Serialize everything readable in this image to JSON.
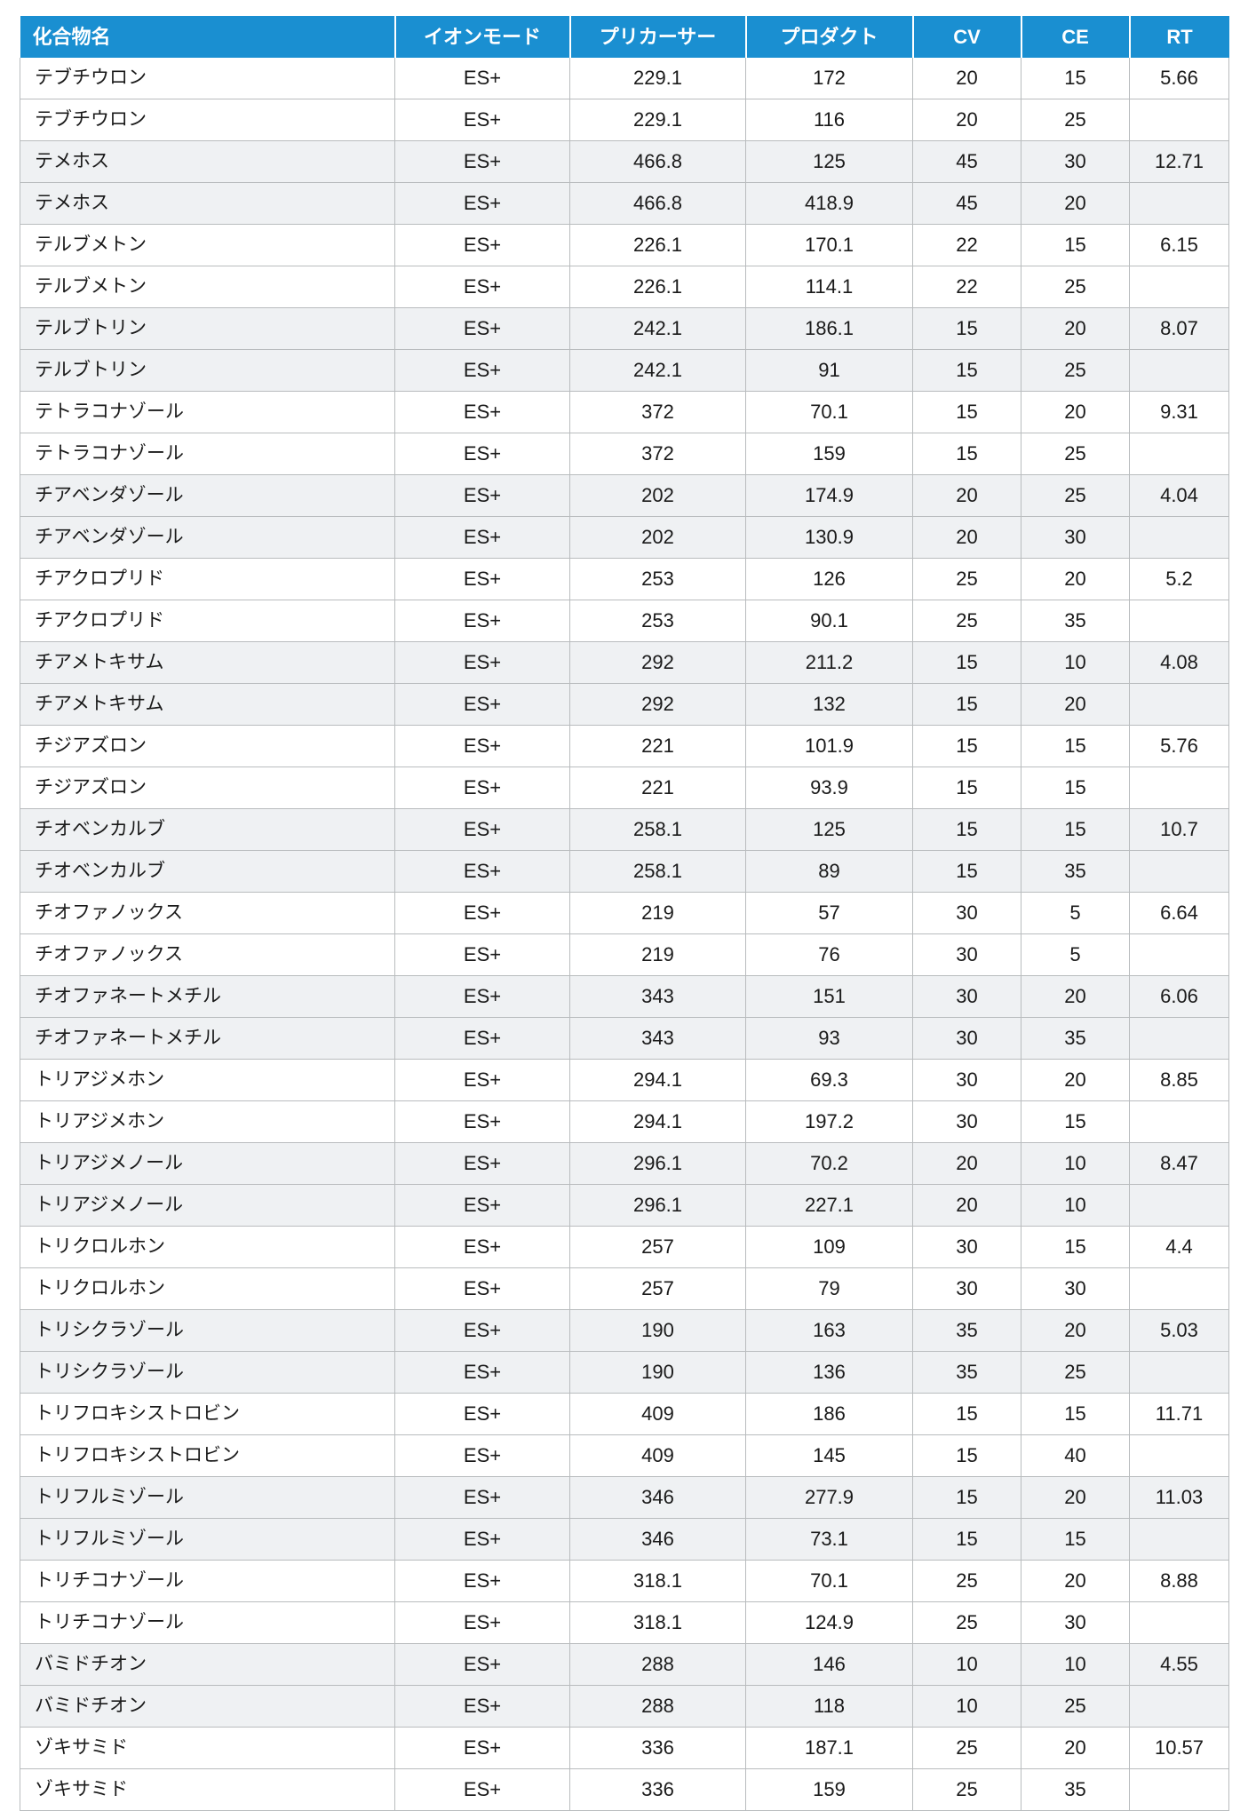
{
  "table": {
    "columns": [
      {
        "key": "name",
        "label": "化合物名",
        "align": "left"
      },
      {
        "key": "ion_mode",
        "label": "イオンモード",
        "align": "center"
      },
      {
        "key": "precursor",
        "label": "プリカーサー",
        "align": "center"
      },
      {
        "key": "product",
        "label": "プロダクト",
        "align": "center"
      },
      {
        "key": "cv",
        "label": "CV",
        "align": "center"
      },
      {
        "key": "ce",
        "label": "CE",
        "align": "center"
      },
      {
        "key": "rt",
        "label": "RT",
        "align": "center"
      }
    ],
    "header_bg": "#1a8fd1",
    "header_fg": "#ffffff",
    "row_bg_a": "#ffffff",
    "row_bg_b": "#eff1f3",
    "border_color": "#b9bcbe",
    "rows": [
      {
        "name": "テブチウロン",
        "ion_mode": "ES+",
        "precursor": "229.1",
        "product": "172",
        "cv": "20",
        "ce": "15",
        "rt": "5.66"
      },
      {
        "name": "テブチウロン",
        "ion_mode": "ES+",
        "precursor": "229.1",
        "product": "116",
        "cv": "20",
        "ce": "25",
        "rt": ""
      },
      {
        "name": "テメホス",
        "ion_mode": "ES+",
        "precursor": "466.8",
        "product": "125",
        "cv": "45",
        "ce": "30",
        "rt": "12.71"
      },
      {
        "name": "テメホス",
        "ion_mode": "ES+",
        "precursor": "466.8",
        "product": "418.9",
        "cv": "45",
        "ce": "20",
        "rt": ""
      },
      {
        "name": "テルブメトン",
        "ion_mode": "ES+",
        "precursor": "226.1",
        "product": "170.1",
        "cv": "22",
        "ce": "15",
        "rt": "6.15"
      },
      {
        "name": "テルブメトン",
        "ion_mode": "ES+",
        "precursor": "226.1",
        "product": "114.1",
        "cv": "22",
        "ce": "25",
        "rt": ""
      },
      {
        "name": "テルブトリン",
        "ion_mode": "ES+",
        "precursor": "242.1",
        "product": "186.1",
        "cv": "15",
        "ce": "20",
        "rt": "8.07"
      },
      {
        "name": "テルブトリン",
        "ion_mode": "ES+",
        "precursor": "242.1",
        "product": "91",
        "cv": "15",
        "ce": "25",
        "rt": ""
      },
      {
        "name": "テトラコナゾール",
        "ion_mode": "ES+",
        "precursor": "372",
        "product": "70.1",
        "cv": "15",
        "ce": "20",
        "rt": "9.31"
      },
      {
        "name": "テトラコナゾール",
        "ion_mode": "ES+",
        "precursor": "372",
        "product": "159",
        "cv": "15",
        "ce": "25",
        "rt": ""
      },
      {
        "name": "チアベンダゾール",
        "ion_mode": "ES+",
        "precursor": "202",
        "product": "174.9",
        "cv": "20",
        "ce": "25",
        "rt": "4.04"
      },
      {
        "name": "チアベンダゾール",
        "ion_mode": "ES+",
        "precursor": "202",
        "product": "130.9",
        "cv": "20",
        "ce": "30",
        "rt": ""
      },
      {
        "name": "チアクロプリド",
        "ion_mode": "ES+",
        "precursor": "253",
        "product": "126",
        "cv": "25",
        "ce": "20",
        "rt": "5.2"
      },
      {
        "name": "チアクロプリド",
        "ion_mode": "ES+",
        "precursor": "253",
        "product": "90.1",
        "cv": "25",
        "ce": "35",
        "rt": ""
      },
      {
        "name": "チアメトキサム",
        "ion_mode": "ES+",
        "precursor": "292",
        "product": "211.2",
        "cv": "15",
        "ce": "10",
        "rt": "4.08"
      },
      {
        "name": "チアメトキサム",
        "ion_mode": "ES+",
        "precursor": "292",
        "product": "132",
        "cv": "15",
        "ce": "20",
        "rt": ""
      },
      {
        "name": "チジアズロン",
        "ion_mode": "ES+",
        "precursor": "221",
        "product": "101.9",
        "cv": "15",
        "ce": "15",
        "rt": "5.76"
      },
      {
        "name": "チジアズロン",
        "ion_mode": "ES+",
        "precursor": "221",
        "product": "93.9",
        "cv": "15",
        "ce": "15",
        "rt": ""
      },
      {
        "name": "チオベンカルブ",
        "ion_mode": "ES+",
        "precursor": "258.1",
        "product": "125",
        "cv": "15",
        "ce": "15",
        "rt": "10.7"
      },
      {
        "name": "チオベンカルブ",
        "ion_mode": "ES+",
        "precursor": "258.1",
        "product": "89",
        "cv": "15",
        "ce": "35",
        "rt": ""
      },
      {
        "name": "チオファノックス",
        "ion_mode": "ES+",
        "precursor": "219",
        "product": "57",
        "cv": "30",
        "ce": "5",
        "rt": "6.64"
      },
      {
        "name": "チオファノックス",
        "ion_mode": "ES+",
        "precursor": "219",
        "product": "76",
        "cv": "30",
        "ce": "5",
        "rt": ""
      },
      {
        "name": "チオファネートメチル",
        "ion_mode": "ES+",
        "precursor": "343",
        "product": "151",
        "cv": "30",
        "ce": "20",
        "rt": "6.06"
      },
      {
        "name": "チオファネートメチル",
        "ion_mode": "ES+",
        "precursor": "343",
        "product": "93",
        "cv": "30",
        "ce": "35",
        "rt": ""
      },
      {
        "name": "トリアジメホン",
        "ion_mode": "ES+",
        "precursor": "294.1",
        "product": "69.3",
        "cv": "30",
        "ce": "20",
        "rt": "8.85"
      },
      {
        "name": "トリアジメホン",
        "ion_mode": "ES+",
        "precursor": "294.1",
        "product": "197.2",
        "cv": "30",
        "ce": "15",
        "rt": ""
      },
      {
        "name": "トリアジメノール",
        "ion_mode": "ES+",
        "precursor": "296.1",
        "product": "70.2",
        "cv": "20",
        "ce": "10",
        "rt": "8.47"
      },
      {
        "name": "トリアジメノール",
        "ion_mode": "ES+",
        "precursor": "296.1",
        "product": "227.1",
        "cv": "20",
        "ce": "10",
        "rt": ""
      },
      {
        "name": "トリクロルホン",
        "ion_mode": "ES+",
        "precursor": "257",
        "product": "109",
        "cv": "30",
        "ce": "15",
        "rt": "4.4"
      },
      {
        "name": "トリクロルホン",
        "ion_mode": "ES+",
        "precursor": "257",
        "product": "79",
        "cv": "30",
        "ce": "30",
        "rt": ""
      },
      {
        "name": "トリシクラゾール",
        "ion_mode": "ES+",
        "precursor": "190",
        "product": "163",
        "cv": "35",
        "ce": "20",
        "rt": "5.03"
      },
      {
        "name": "トリシクラゾール",
        "ion_mode": "ES+",
        "precursor": "190",
        "product": "136",
        "cv": "35",
        "ce": "25",
        "rt": ""
      },
      {
        "name": "トリフロキシストロビン",
        "ion_mode": "ES+",
        "precursor": "409",
        "product": "186",
        "cv": "15",
        "ce": "15",
        "rt": "11.71"
      },
      {
        "name": "トリフロキシストロビン",
        "ion_mode": "ES+",
        "precursor": "409",
        "product": "145",
        "cv": "15",
        "ce": "40",
        "rt": ""
      },
      {
        "name": "トリフルミゾール",
        "ion_mode": "ES+",
        "precursor": "346",
        "product": "277.9",
        "cv": "15",
        "ce": "20",
        "rt": "11.03"
      },
      {
        "name": "トリフルミゾール",
        "ion_mode": "ES+",
        "precursor": "346",
        "product": "73.1",
        "cv": "15",
        "ce": "15",
        "rt": ""
      },
      {
        "name": "トリチコナゾール",
        "ion_mode": "ES+",
        "precursor": "318.1",
        "product": "70.1",
        "cv": "25",
        "ce": "20",
        "rt": "8.88"
      },
      {
        "name": "トリチコナゾール",
        "ion_mode": "ES+",
        "precursor": "318.1",
        "product": "124.9",
        "cv": "25",
        "ce": "30",
        "rt": ""
      },
      {
        "name": "バミドチオン",
        "ion_mode": "ES+",
        "precursor": "288",
        "product": "146",
        "cv": "10",
        "ce": "10",
        "rt": "4.55"
      },
      {
        "name": "バミドチオン",
        "ion_mode": "ES+",
        "precursor": "288",
        "product": "118",
        "cv": "10",
        "ce": "25",
        "rt": ""
      },
      {
        "name": "ゾキサミド",
        "ion_mode": "ES+",
        "precursor": "336",
        "product": "187.1",
        "cv": "25",
        "ce": "20",
        "rt": "10.57"
      },
      {
        "name": "ゾキサミド",
        "ion_mode": "ES+",
        "precursor": "336",
        "product": "159",
        "cv": "25",
        "ce": "35",
        "rt": ""
      }
    ]
  }
}
